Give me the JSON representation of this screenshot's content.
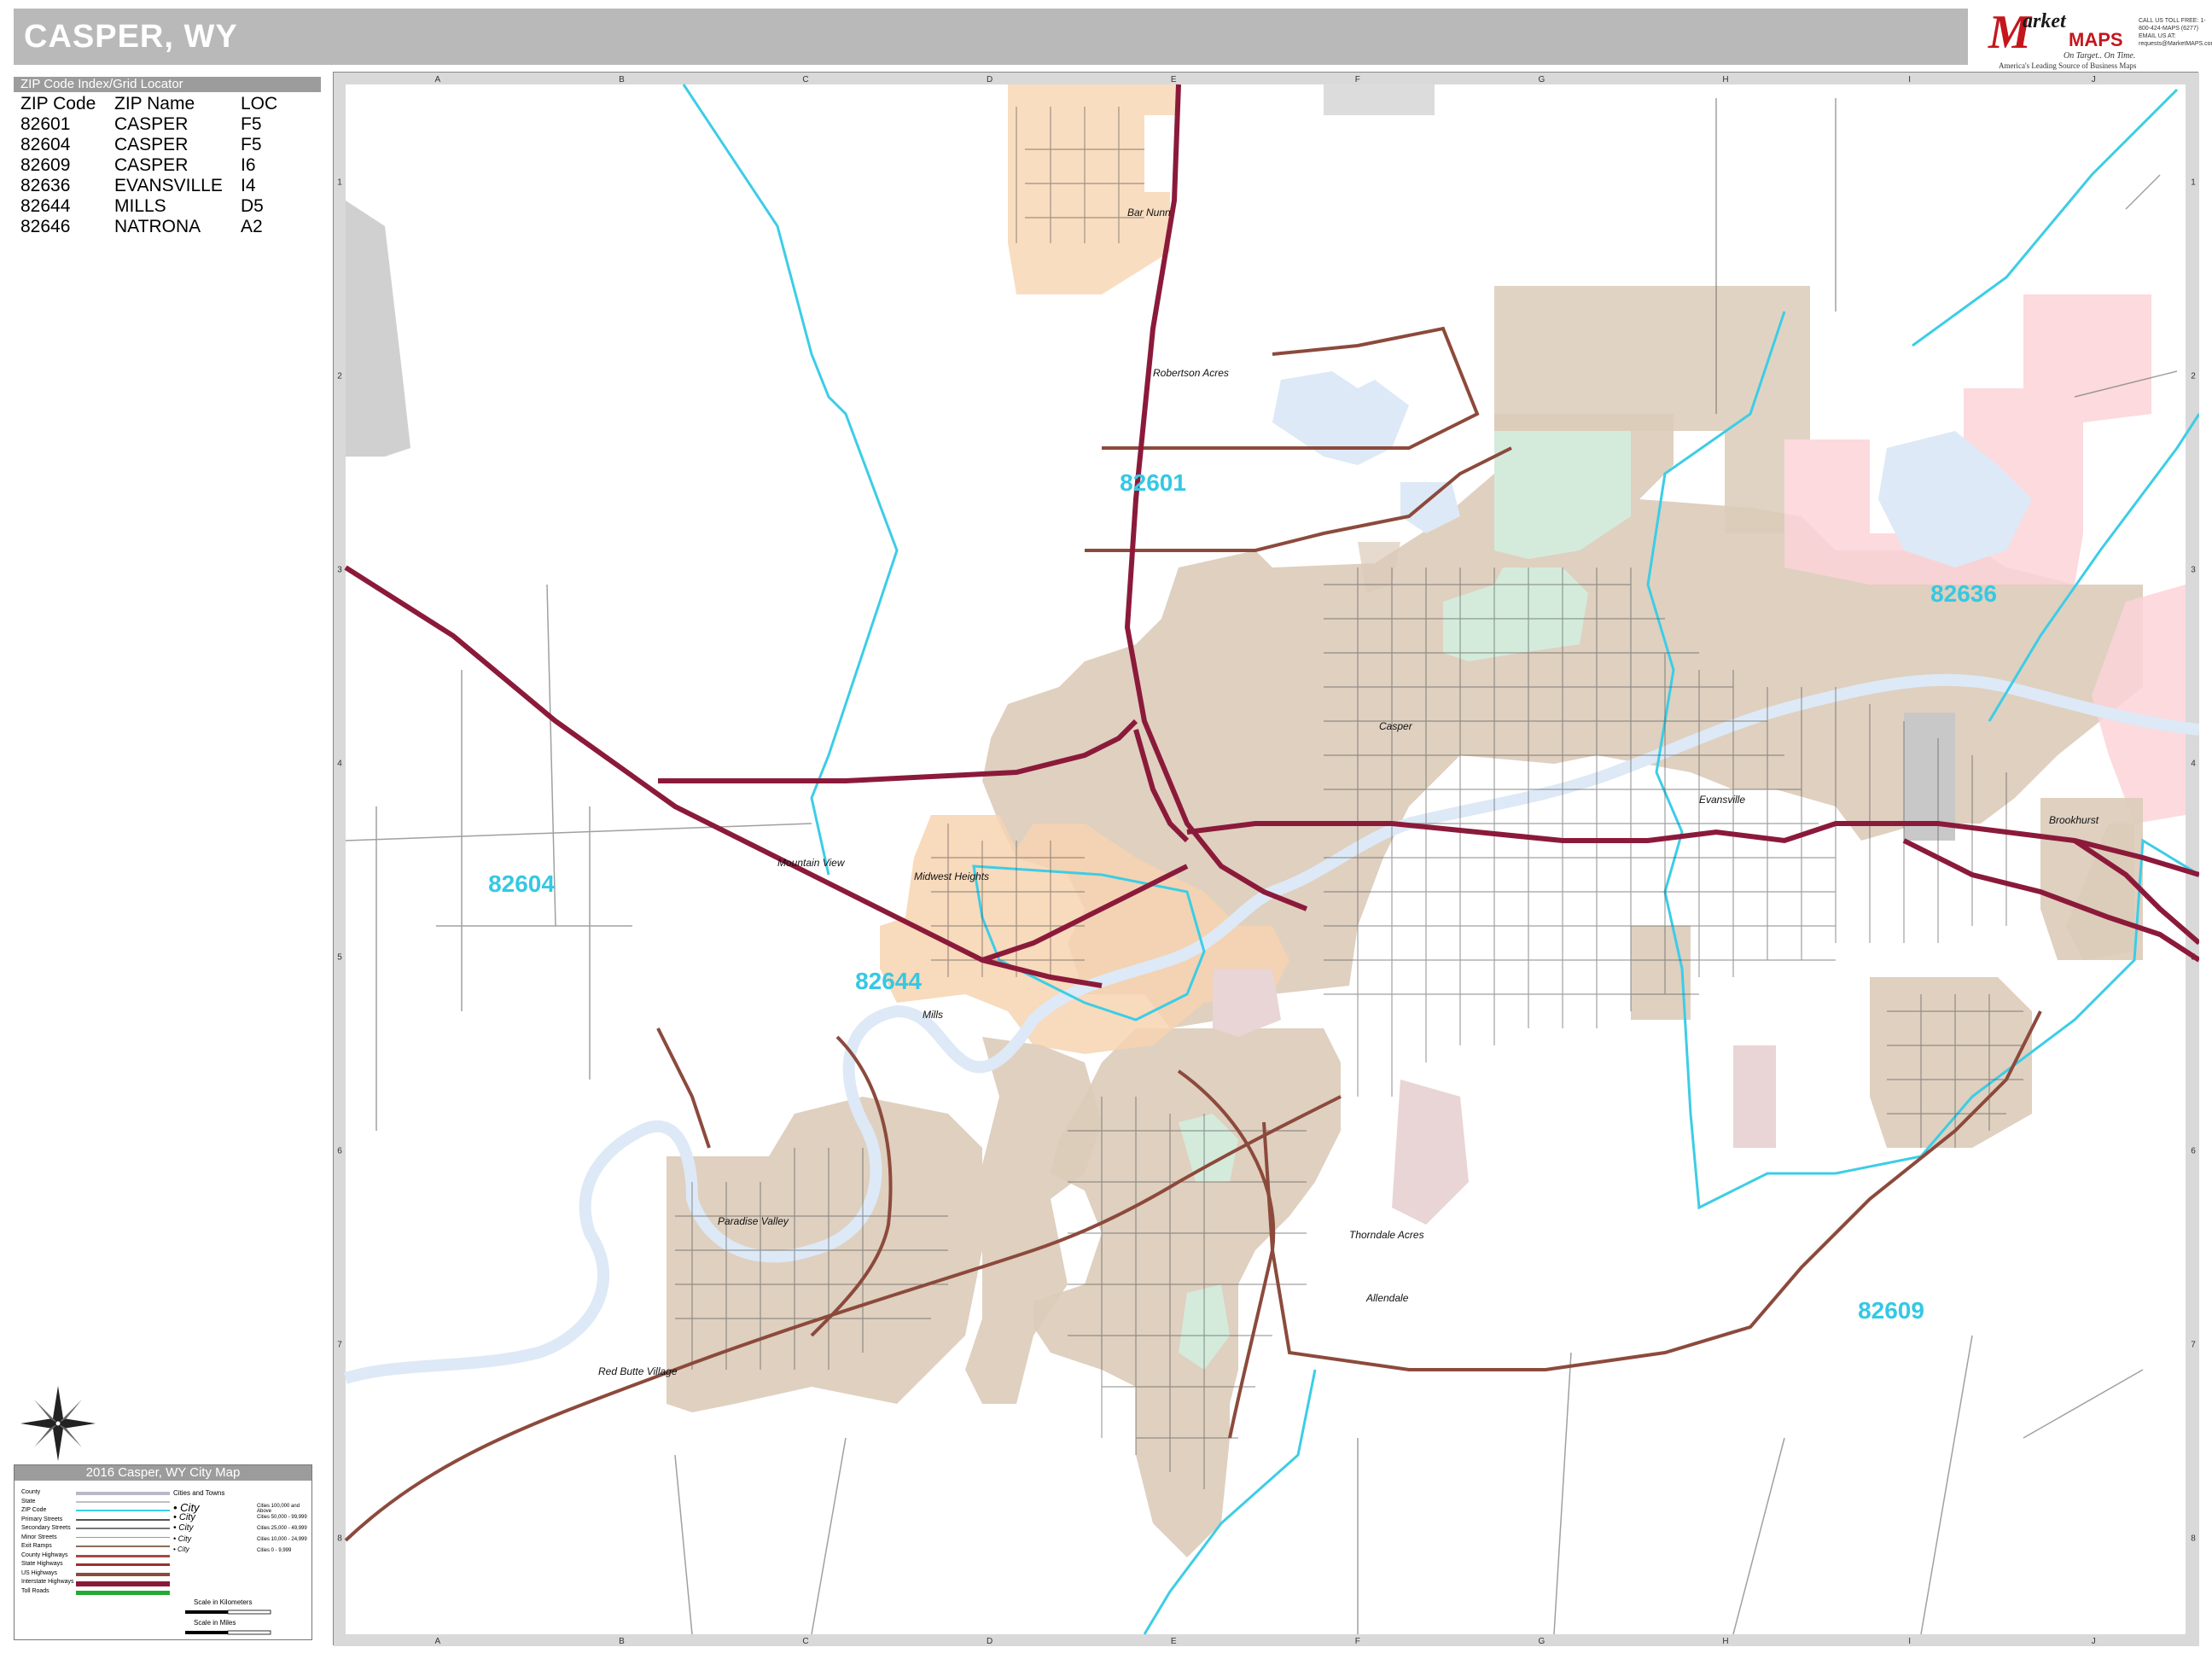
{
  "title": "CASPER, WY",
  "logo": {
    "brand_initial": "M",
    "brand_word1": "arket",
    "brand_word2": "MAPS",
    "tagline": "On Target.. On Time.",
    "subtagline": "America's Leading Source of Business Maps",
    "contact": "CALL US TOLL FREE: 1-800-424-MAPS (6277) EMAIL US AT: requests@MarketMAPS.com"
  },
  "zip_index": {
    "header": "ZIP Code Index/Grid Locator",
    "columns": [
      "ZIP Code",
      "ZIP Name",
      "LOC"
    ],
    "rows": [
      [
        "82601",
        "CASPER",
        "F5"
      ],
      [
        "82604",
        "CASPER",
        "F5"
      ],
      [
        "82609",
        "CASPER",
        "I6"
      ],
      [
        "82636",
        "EVANSVILLE",
        "I4"
      ],
      [
        "82644",
        "MILLS",
        "D5"
      ],
      [
        "82646",
        "NATRONA",
        "A2"
      ]
    ]
  },
  "grid": {
    "columns": [
      "A",
      "B",
      "C",
      "D",
      "E",
      "F",
      "G",
      "H",
      "I",
      "J"
    ],
    "rows": [
      "1",
      "2",
      "3",
      "4",
      "5",
      "6",
      "7",
      "8"
    ]
  },
  "zip_labels": [
    "82601",
    "82604",
    "82636",
    "82644",
    "82609"
  ],
  "place_labels": [
    "Bar Nunn",
    "Robertson Acres",
    "Casper",
    "Mountain View",
    "Midwest Heights",
    "Mills",
    "Evansville",
    "Brookhurst",
    "Paradise Valley",
    "Red Butte Village",
    "Thorndale Acres",
    "Allendale"
  ],
  "legend": {
    "header": "2016 Casper, WY City Map",
    "items": [
      "County",
      "State",
      "ZIP Code",
      "Primary Streets",
      "Secondary Streets",
      "Minor Streets",
      "Exit Ramps",
      "County Highways",
      "State Highways",
      "US Highways",
      "Interstate Highways",
      "Toll Roads"
    ],
    "cities_title": "Cities and Towns",
    "cities": [
      "City",
      "City",
      "City",
      "City",
      "City"
    ],
    "ranges": [
      "Cities 100,000 and Above",
      "Cities 50,000 - 99,999",
      "Cities 25,000 - 49,999",
      "Cities 10,000 - 24,999",
      "Cities 0 - 9,999"
    ],
    "scale_km": "Scale in Kilometers",
    "scale_mi": "Scale in Miles"
  },
  "colors": {
    "city_tan": "#dccbb9",
    "mills_peach": "#f7d4b0",
    "evansville_pink": "#fbd3d8",
    "park_green": "#d4ebdc",
    "water_blue": "#dde9f6",
    "zip_line": "#3ccde6",
    "highway": "#8b1a3a",
    "us_highway": "#8c4a3c"
  }
}
